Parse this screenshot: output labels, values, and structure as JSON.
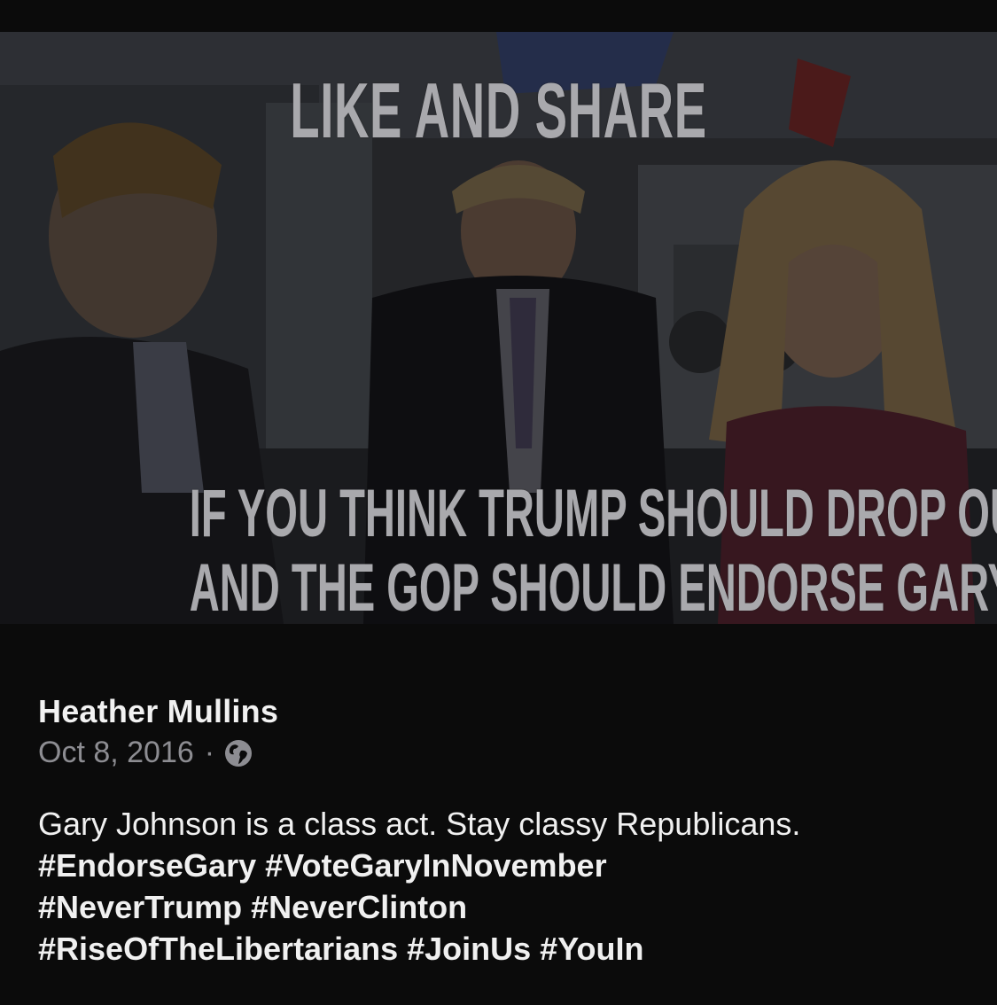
{
  "photo": {
    "headline": "LIKE AND SHARE",
    "subline_1": "IF YOU THINK TRUMP SHOULD DROP OUT",
    "subline_2": "AND THE GOP SHOULD ENDORSE GARY JOHNSON"
  },
  "post": {
    "author": "Heather Mullins",
    "date": "Oct 8, 2016",
    "separator": "·",
    "audience_icon": "globe-icon",
    "text": "Gary Johnson is a class act. Stay classy Republicans.",
    "hashtag_lines": [
      "#EndorseGary #VoteGaryInNovember",
      "#NeverTrump #NeverClinton",
      "#RiseOfTheLibertarians #JoinUs #YouIn"
    ]
  },
  "colors": {
    "background": "#0b0b0b",
    "author": "#f2f2f2",
    "meta": "#8d8d92",
    "overlay_text": "#a9a9ad"
  }
}
